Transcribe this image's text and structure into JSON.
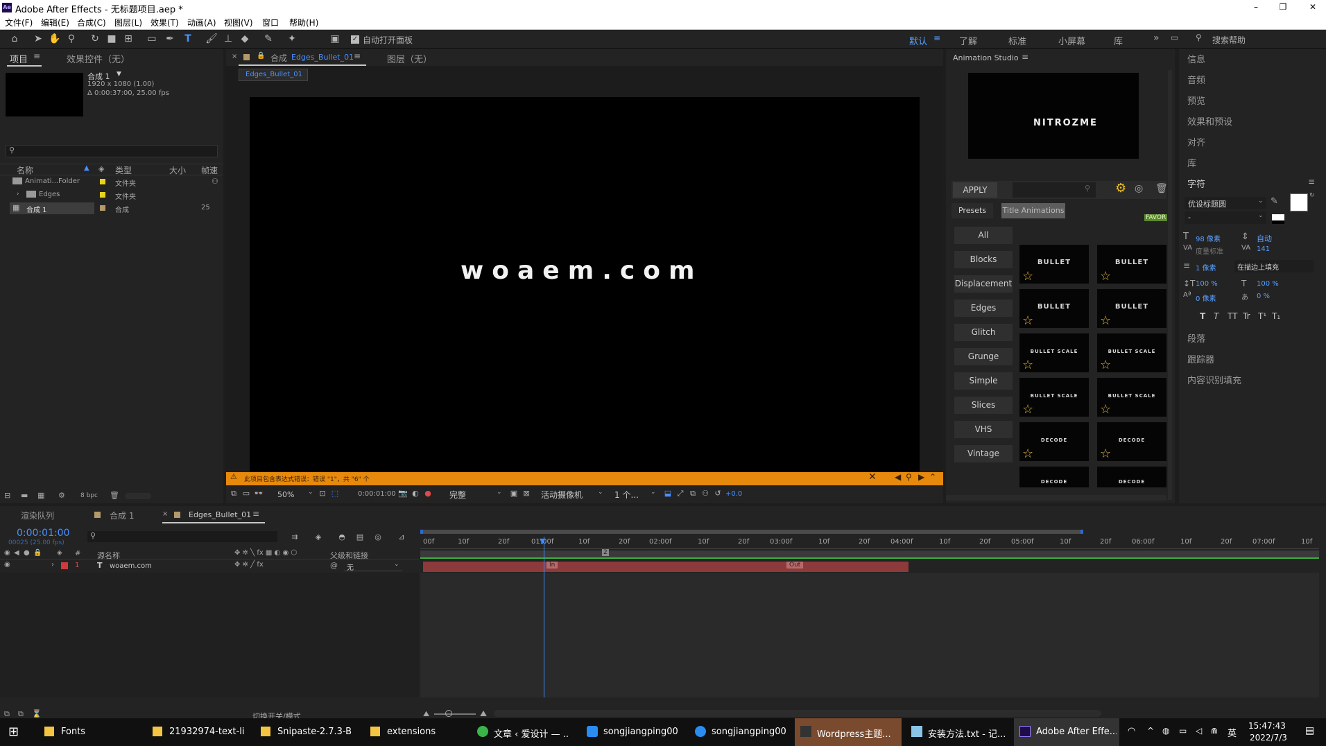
{
  "window": {
    "title": "Adobe After Effects - 无标题项目.aep *",
    "app_badge": "Ae"
  },
  "menu": [
    "文件(F)",
    "编辑(E)",
    "合成(C)",
    "图层(L)",
    "效果(T)",
    "动画(A)",
    "视图(V)",
    "窗口",
    "帮助(H)"
  ],
  "toolbar": {
    "auto_open_label": "自动打开面板",
    "workspaces": [
      "默认",
      "了解",
      "标准",
      "小屏幕",
      "库"
    ],
    "search_placeholder": "搜索帮助"
  },
  "project": {
    "tab_project": "项目",
    "tab_effects": "效果控件（无）",
    "comp_name": "合成 1",
    "comp_res": "1920 x 1080 (1.00)",
    "comp_dur": "Δ 0:00:37:00, 25.00 fps",
    "col_name": "名称",
    "col_type": "类型",
    "col_size": "大小",
    "col_fps": "帧速",
    "rows": [
      {
        "name": "Animati...Folder",
        "type": "文件夹",
        "fps": ""
      },
      {
        "name": "Edges",
        "type": "文件夹",
        "fps": ""
      },
      {
        "name": "合成 1",
        "type": "合成",
        "fps": "25"
      }
    ],
    "bpc": "8 bpc"
  },
  "comp": {
    "tab_label": "合成",
    "tab_comp": "Edges_Bullet_01",
    "tab_layer": "图层（无）",
    "breadcrumb": "Edges_Bullet_01",
    "canvas_text": "woaem.com",
    "warning": "此项目包含表达式错误：错误 \"1\"，共 \"6\" 个",
    "zoom": "50%",
    "timecode": "0:00:01:00",
    "quality": "完整",
    "camera": "活动摄像机",
    "views": "1 个...",
    "exposure": "+0.0"
  },
  "studio": {
    "title": "Animation Studio",
    "logo": "NITROZME",
    "apply": "APPLY",
    "tab_presets": "Presets",
    "tab_title": "Title Animations",
    "favor": "FAVOR",
    "categories": [
      "All",
      "Blocks",
      "Displacement",
      "Edges",
      "Glitch",
      "Grunge",
      "Simple",
      "Slices",
      "VHS",
      "Vintage"
    ],
    "thumbs": [
      "BULLET",
      "BULLET",
      "BULLET",
      "BULLET",
      "BULLET SCALE",
      "BULLET SCALE",
      "BULLET SCALE",
      "BULLET SCALE",
      "DECODE",
      "DECODE",
      "DECODE",
      "DECODE"
    ]
  },
  "right": {
    "items_top": [
      "信息",
      "音频",
      "预览",
      "效果和预设",
      "对齐",
      "库"
    ],
    "char_title": "字符",
    "font": "优设标题圆",
    "style": "-",
    "size": "98 像素",
    "leading": "自动",
    "kerning": "度量标准",
    "tracking": "141",
    "stroke": "1 像素",
    "stroke_mode": "在描边上填充",
    "vscale": "100 %",
    "hscale": "100 %",
    "baseline": "0 像素",
    "tsume": "0 %",
    "styles": [
      "T",
      "T",
      "TT",
      "Tr",
      "T¹",
      "T₁"
    ],
    "items_bottom": [
      "段落",
      "跟踪器",
      "内容识别填充"
    ]
  },
  "timeline": {
    "tab_render": "渲染队列",
    "tab_comp1": "合成 1",
    "tab_edges": "Edges_Bullet_01",
    "timecode": "0:00:01:00",
    "frames": "00025 (25.00 fps)",
    "col_source": "源名称",
    "col_parent": "父级和链接",
    "layer_index": "1",
    "layer_name": "woaem.com",
    "parent": "无",
    "toggle": "切换开关/模式",
    "ruler": [
      "00f",
      "10f",
      "20f",
      "01:00f",
      "10f",
      "20f",
      "02:00f",
      "10f",
      "20f",
      "03:00f",
      "10f",
      "20f",
      "04:00f",
      "10f",
      "20f",
      "05:00f",
      "10f",
      "20f",
      "06:00f",
      "10f",
      "20f",
      "07:00f",
      "10f"
    ],
    "marker_in": "In",
    "marker_out": "Out"
  },
  "taskbar": {
    "items": [
      "Fonts",
      "21932974-text-li...",
      "Snipaste-2.7.3-B...",
      "extensions",
      "文章 ‹ 爱设计 — ...",
      "songjiangping00...",
      "songjiangping00...",
      "Wordpress主题...",
      "安装方法.txt - 记...",
      "Adobe After Effe..."
    ],
    "time": "15:47:43",
    "date": "2022/7/3",
    "ime": "英"
  }
}
